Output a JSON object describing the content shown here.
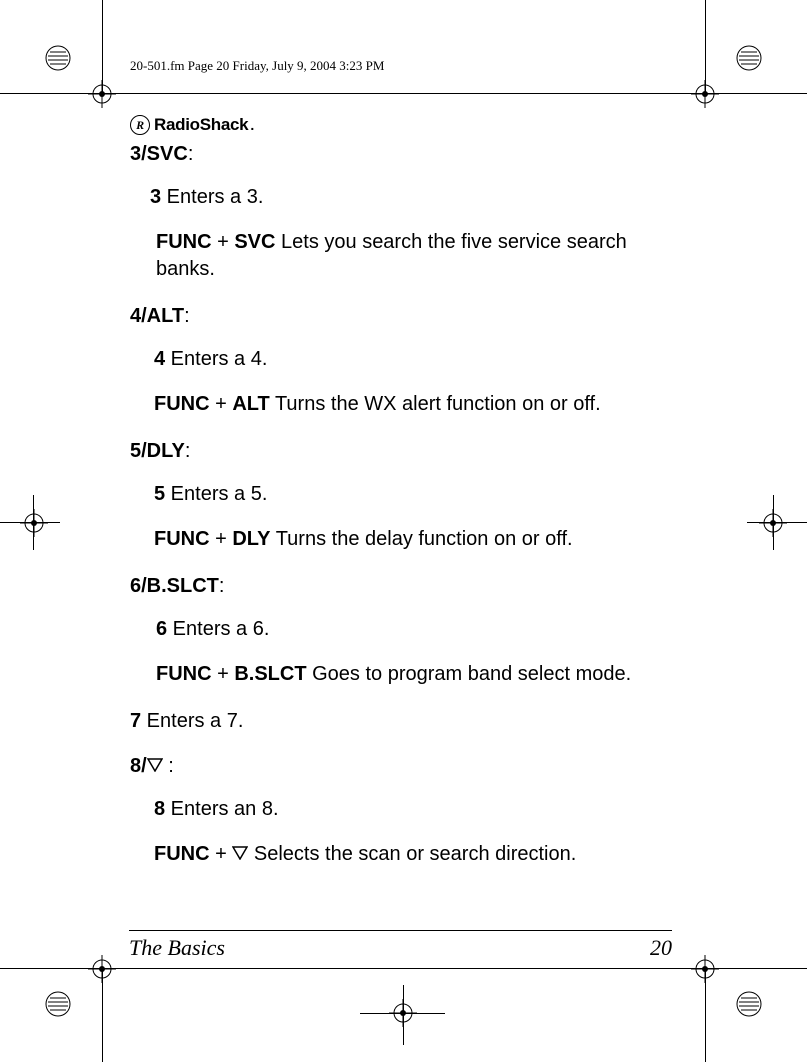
{
  "meta": {
    "header": "20-501.fm  Page 20  Friday, July 9, 2004  3:23 PM"
  },
  "brand": {
    "r": "R",
    "name": "RadioShack",
    "dot": "."
  },
  "s3": {
    "head_b": "3/SVC",
    "head_tail": ":",
    "l1_b": "3",
    "l1_t": " Enters a 3.",
    "l2_b1": "FUNC",
    "l2_mid": " + ",
    "l2_b2": "SVC",
    "l2_t": " Lets you search the five service search banks."
  },
  "s4": {
    "head_b": "4/ALT",
    "head_tail": ":",
    "l1_b": "4",
    "l1_t": " Enters a 4.",
    "l2_b1": "FUNC",
    "l2_mid": " + ",
    "l2_b2": "ALT",
    "l2_t": " Turns the WX alert function on or off."
  },
  "s5": {
    "head_b": "5/DLY",
    "head_tail": ":",
    "l1_b": "5",
    "l1_t": " Enters a 5.",
    "l2_b1": "FUNC",
    "l2_mid": " + ",
    "l2_b2": "DLY",
    "l2_t": " Turns the delay function on or off."
  },
  "s6": {
    "head_b": "6/B.SLCT",
    "head_tail": ":",
    "l1_b": "6",
    "l1_t": " Enters a 6.",
    "l2_b1": "FUNC",
    "l2_mid": " + ",
    "l2_b2": "B.SLCT",
    "l2_t": " Goes to program band select mode."
  },
  "s7": {
    "b": "7",
    "t": " Enters a 7."
  },
  "s8": {
    "head_b": "8/",
    "head_tail": " :",
    "l1_b": "8",
    "l1_t": " Enters an 8.",
    "l2_b1": "FUNC",
    "l2_mid": " +  ",
    "l2_t": "  Selects the scan or search direction."
  },
  "footer": {
    "title": "The Basics",
    "page": "20"
  }
}
